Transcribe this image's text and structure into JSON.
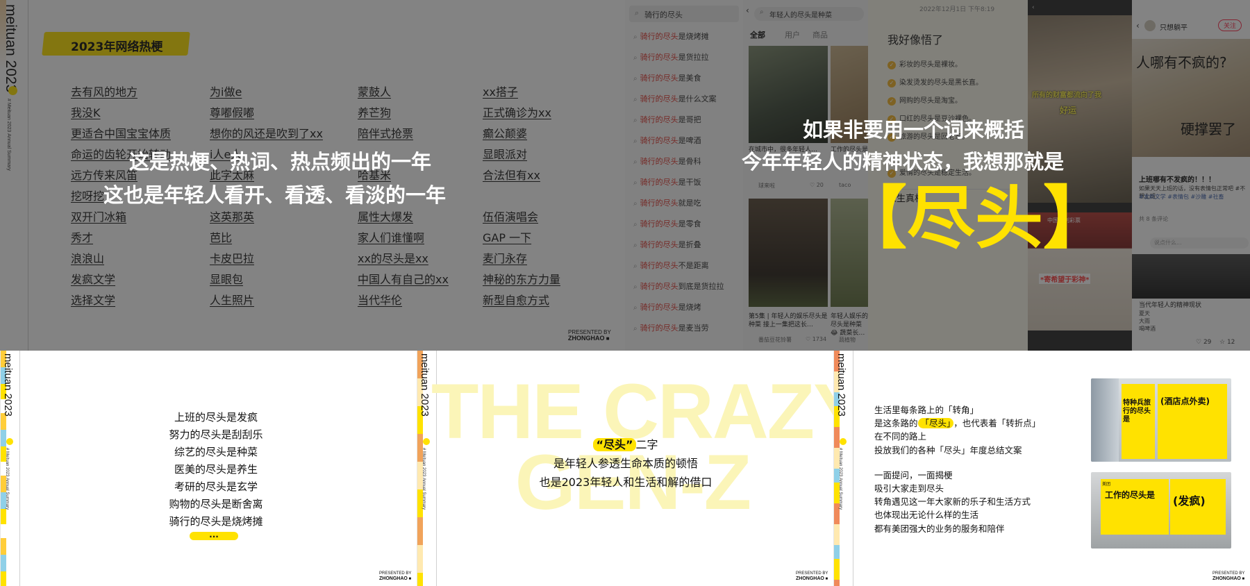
{
  "brand": {
    "name": "meituan 2023",
    "sub_line1": "# Meituan 2023",
    "sub_line2": "Annual Summary"
  },
  "presented": {
    "line1": "PRESENTED BY",
    "line2": "ZHONGHAO"
  },
  "panel1": {
    "title": "2023年网络热梗",
    "columns": [
      [
        "去有风的地方",
        "我没K",
        "更适合中国宝宝体质",
        "命运的齿轮开始转动",
        "远方传来风笛",
        "挖呀挖",
        "双开门冰箱",
        "秀才",
        "浪浪山",
        "发疯文学",
        "选择文学"
      ],
      [
        "为i做e",
        "尊嘟假嘟",
        "想你的风还是吹到了xx",
        "i人e人",
        "此字太麻",
        "",
        "这英那英",
        "芭比",
        "卡皮巴拉",
        "显眼包",
        "人生照片"
      ],
      [
        "蒙鼓人",
        "养芒狗",
        "陪伴式抢票",
        "",
        "哈基米",
        "",
        "属性大爆发",
        "家人们谁懂啊",
        "xx的尽头是xx",
        "中国人有自己的xx",
        "当代华伦"
      ],
      [
        "xx搭子",
        "正式确诊为xx",
        "癫公颠婆",
        "显眼派对",
        "合法但有xx",
        "",
        "伍佰演唱会",
        "GAP 一下",
        "麦门永存",
        "神秘的东方力量",
        "新型自愈方式"
      ]
    ],
    "caption_line1": "这是热梗、热词、热点频出的一年",
    "caption_line2": "这也是年轻人看开、看透、看淡的一年"
  },
  "search": {
    "query": "骑行的尽头",
    "suggestions": [
      {
        "hl": "骑行的尽头",
        "rest": "是烧烤摊"
      },
      {
        "hl": "骑行的尽头",
        "rest": "是货拉拉"
      },
      {
        "hl": "骑行的尽头",
        "rest": "是美食"
      },
      {
        "hl": "骑行的尽头",
        "rest": "是什么文案"
      },
      {
        "hl": "骑行的尽头",
        "rest": "是哥把"
      },
      {
        "hl": "骑行的尽头",
        "rest": "是啤酒"
      },
      {
        "hl": "骑行的尽头",
        "rest": "是骨科"
      },
      {
        "hl": "骑行的尽头",
        "rest": "是干饭"
      },
      {
        "hl": "骑行的尽头",
        "rest": "就是吃"
      },
      {
        "hl": "骑行的尽头",
        "rest": "是零食"
      },
      {
        "hl": "骑行的尽头",
        "rest": "是折叠"
      },
      {
        "hl": "骑行的尽头",
        "rest": "不是距离"
      },
      {
        "hl": "骑行的尽头",
        "rest": "到底是货拉拉"
      },
      {
        "hl": "骑行的尽头",
        "rest": "是烧烤"
      },
      {
        "hl": "骑行的尽头",
        "rest": "是麦当劳"
      }
    ]
  },
  "app": {
    "search_query": "年轻人的尽头是种菜",
    "tabs": [
      "全部",
      "用户",
      "商品"
    ],
    "date": "2022年12月1日 下午8:19",
    "note_title": "我好像悟了",
    "notes": [
      "彩妆的尽头是裸妆。",
      "染发烫发的尽头是黑长直。",
      "网购的尽头是淘宝。",
      "口红的尽头是豆沙裸色。",
      "旅游的尽头是回老家。",
      "",
      "爱情的尽头是稳定生活。"
    ],
    "card1_text": "在城市中，很多年轻人…",
    "card1_user": "球来啦",
    "card1_likes": "20",
    "card2_text": "工作的尽头是…",
    "card2_user": "taco",
    "card3_text": "第5集 | 年轻人的娱乐尽头是种菜 接上一集把这长…",
    "card3_user": "番茄豆花铃薯",
    "card3_likes": "1734",
    "card4_text": "年轻人娱乐的尽头是种菜 😂 蔬菜长…",
    "card4_user": "蔬植物",
    "post_user": "只想躺平",
    "follow": "关注",
    "post_text1": "人哪有不疯的?",
    "post_text2": "硬撑罢了",
    "post_tags": "#发疯文学 #表情包 #沙雕 #社畜",
    "post_caption": "上班哪有不发疯的！！！",
    "post_desc": "如果天天上班的话，没有表情包正常吧 #不想上班",
    "post_footer": "当代年轻人的精神现状",
    "comments": "共 8 条评论",
    "comment_input": "说点什么...",
    "list_items": [
      "夏天",
      "大雨",
      "喝啤酒"
    ],
    "likes": "29",
    "stars": "12",
    "overlay_cat": "所有的财富都流向了我",
    "overlay_luck": "好运",
    "overlay_store": "中国福利彩票",
    "overlay_lottery": "*寄希望于彩神*",
    "caption_line1": "如果非要用一个词来概括",
    "caption_line2": "今年年轻人的精神状态，我想那就是",
    "big_word": "【尽头】"
  },
  "panel4": {
    "lines": [
      "上班的尽头是发疯",
      "努力的尽头是刮刮乐",
      "综艺的尽头是种菜",
      "医美的尽头是养生",
      "考研的尽头是玄学",
      "购物的尽头是断舍离",
      "骑行的尽头是烧烤摊"
    ],
    "more": "..."
  },
  "panel5": {
    "ghost1": "THE CRAZY",
    "ghost2": "GEN-Z",
    "line1_hl": "“尽头”",
    "line1_rest": "二字",
    "line2": "是年轻人参透生命本质的顿悟",
    "line3": "也是2023年轻人和生活和解的借口"
  },
  "panel6": {
    "line1": "生活里每条路上的「转角」",
    "line2_a": "是这条路的",
    "line2_hl": "「尽头」",
    "line2_b": "，也代表着「转折点」",
    "line3": "在不同的路上",
    "line4": "投放我们的各种「尽头」年度总结文案",
    "line5": "一面提问，一面揭梗",
    "line6": "吸引大家走到尽头",
    "line7": "转角遇见这一年大家新的乐子和生活方式",
    "line8": "也体现出无论什么样的生活",
    "line9": "都有美团强大的业务的服务和陪伴",
    "ad1_title": "特种兵旅行的尽头是",
    "ad1_answer": "(酒店点外卖)",
    "ad2_title": "工作的尽头是",
    "ad2_answer": "(发疯)",
    "ad_logo": "美团"
  },
  "colors": {
    "accent": "#ffe200",
    "highlight_red": "#e0342d",
    "dim_overlay": "#1e1e1e"
  }
}
